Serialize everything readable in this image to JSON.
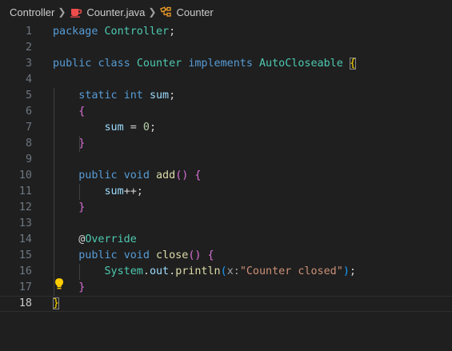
{
  "breadcrumb": {
    "folder": "Controller",
    "file": "Counter.java",
    "symbol": "Counter"
  },
  "colors": {
    "background": "#1f1f1f",
    "keyword": "#569cd6",
    "type": "#4ec9b0",
    "variable": "#9cdcfe",
    "function": "#dcdcaa",
    "number": "#b5cea8",
    "string": "#ce9178",
    "bracket_level1": "#ffd700",
    "bracket_level2": "#da70d6",
    "bracket_level3": "#179fff",
    "java_icon": "#f14c4c",
    "class_icon": "#ee9d28",
    "lightbulb": "#ffcc00"
  },
  "lines": [
    {
      "n": "1",
      "tokens": [
        {
          "t": "package",
          "c": "kw"
        },
        {
          "t": " ",
          "c": "plain"
        },
        {
          "t": "Controller",
          "c": "typ"
        },
        {
          "t": ";",
          "c": "plain"
        }
      ]
    },
    {
      "n": "2",
      "tokens": []
    },
    {
      "n": "3",
      "tokens": [
        {
          "t": "public",
          "c": "kw"
        },
        {
          "t": " ",
          "c": "plain"
        },
        {
          "t": "class",
          "c": "kw"
        },
        {
          "t": " ",
          "c": "plain"
        },
        {
          "t": "Counter",
          "c": "typ"
        },
        {
          "t": " ",
          "c": "plain"
        },
        {
          "t": "implements",
          "c": "kw"
        },
        {
          "t": " ",
          "c": "plain"
        },
        {
          "t": "AutoCloseable",
          "c": "typ"
        },
        {
          "t": " ",
          "c": "plain"
        },
        {
          "t": "{",
          "c": "b1 bracket-match"
        }
      ]
    },
    {
      "n": "4",
      "tokens": []
    },
    {
      "n": "5",
      "tokens": [
        {
          "t": "    ",
          "c": "plain"
        },
        {
          "t": "static",
          "c": "kw"
        },
        {
          "t": " ",
          "c": "plain"
        },
        {
          "t": "int",
          "c": "kw"
        },
        {
          "t": " ",
          "c": "plain"
        },
        {
          "t": "sum",
          "c": "var"
        },
        {
          "t": ";",
          "c": "plain"
        }
      ]
    },
    {
      "n": "6",
      "tokens": [
        {
          "t": "    ",
          "c": "plain"
        },
        {
          "t": "{",
          "c": "b2"
        }
      ]
    },
    {
      "n": "7",
      "tokens": [
        {
          "t": "        ",
          "c": "plain"
        },
        {
          "t": "sum",
          "c": "var"
        },
        {
          "t": " = ",
          "c": "plain"
        },
        {
          "t": "0",
          "c": "num"
        },
        {
          "t": ";",
          "c": "plain"
        }
      ]
    },
    {
      "n": "8",
      "tokens": [
        {
          "t": "    ",
          "c": "plain"
        },
        {
          "t": "}",
          "c": "b2"
        }
      ]
    },
    {
      "n": "9",
      "tokens": []
    },
    {
      "n": "10",
      "tokens": [
        {
          "t": "    ",
          "c": "plain"
        },
        {
          "t": "public",
          "c": "kw"
        },
        {
          "t": " ",
          "c": "plain"
        },
        {
          "t": "void",
          "c": "kw"
        },
        {
          "t": " ",
          "c": "plain"
        },
        {
          "t": "add",
          "c": "fn"
        },
        {
          "t": "()",
          "c": "b2"
        },
        {
          "t": " ",
          "c": "plain"
        },
        {
          "t": "{",
          "c": "b2"
        }
      ]
    },
    {
      "n": "11",
      "tokens": [
        {
          "t": "        ",
          "c": "plain"
        },
        {
          "t": "sum",
          "c": "var"
        },
        {
          "t": "++;",
          "c": "plain"
        }
      ]
    },
    {
      "n": "12",
      "tokens": [
        {
          "t": "    ",
          "c": "plain"
        },
        {
          "t": "}",
          "c": "b2"
        }
      ]
    },
    {
      "n": "13",
      "tokens": []
    },
    {
      "n": "14",
      "tokens": [
        {
          "t": "    ",
          "c": "plain"
        },
        {
          "t": "@",
          "c": "plain"
        },
        {
          "t": "Override",
          "c": "typ"
        }
      ]
    },
    {
      "n": "15",
      "tokens": [
        {
          "t": "    ",
          "c": "plain"
        },
        {
          "t": "public",
          "c": "kw"
        },
        {
          "t": " ",
          "c": "plain"
        },
        {
          "t": "void",
          "c": "kw"
        },
        {
          "t": " ",
          "c": "plain"
        },
        {
          "t": "close",
          "c": "fn"
        },
        {
          "t": "()",
          "c": "b2"
        },
        {
          "t": " ",
          "c": "plain"
        },
        {
          "t": "{",
          "c": "b2"
        }
      ]
    },
    {
      "n": "16",
      "tokens": [
        {
          "t": "        ",
          "c": "plain"
        },
        {
          "t": "System",
          "c": "typ"
        },
        {
          "t": ".",
          "c": "plain"
        },
        {
          "t": "out",
          "c": "var"
        },
        {
          "t": ".",
          "c": "plain"
        },
        {
          "t": "println",
          "c": "fn"
        },
        {
          "t": "(",
          "c": "b3"
        },
        {
          "t": "x:",
          "c": "hint"
        },
        {
          "t": "\"Counter closed\"",
          "c": "str"
        },
        {
          "t": ")",
          "c": "b3"
        },
        {
          "t": ";",
          "c": "plain"
        }
      ]
    },
    {
      "n": "17",
      "tokens": [
        {
          "t": "    ",
          "c": "plain"
        },
        {
          "t": "}",
          "c": "b2"
        }
      ]
    },
    {
      "n": "18",
      "tokens": [
        {
          "t": "}",
          "c": "b1 bracket-match"
        }
      ]
    }
  ],
  "active_line": "18",
  "lightbulb_line": "17"
}
